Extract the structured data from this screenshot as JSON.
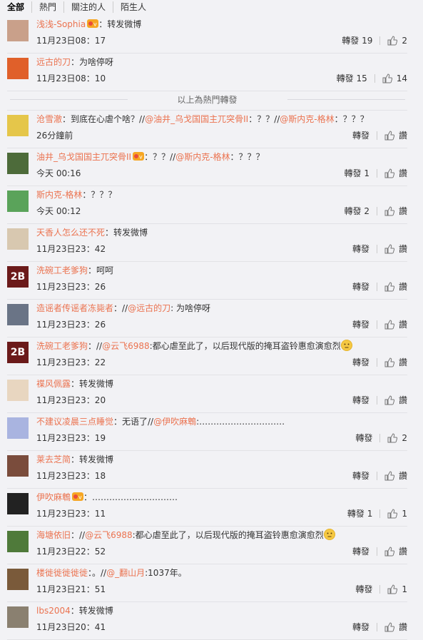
{
  "tabs": [
    "全部",
    "熱門",
    "關注的人",
    "陌生人"
  ],
  "hot_divider": "以上為熱門轉發",
  "like_label": "讚",
  "items": [
    {
      "user": "浅浅-Sophia",
      "vip": true,
      "parts": [
        {
          "t": "：转发微博",
          "m": false
        }
      ],
      "time": "11月23日08：17",
      "repost": "轉發 19",
      "like": "2",
      "av": "#c9a08a"
    },
    {
      "user": "远古的刀",
      "vip": false,
      "parts": [
        {
          "t": "：为啥停呀",
          "m": false
        }
      ],
      "time": "11月23日08：10",
      "repost": "轉發 15",
      "like": "14",
      "av": "#e0602a"
    },
    {
      "divider": true
    },
    {
      "user": "沧雪澈",
      "vip": false,
      "parts": [
        {
          "t": "：到底在心虐个啥？//",
          "m": false
        },
        {
          "t": "@油井_乌戈国国主兀突骨II",
          "m": true
        },
        {
          "t": "：？？//",
          "m": false
        },
        {
          "t": "@斯内克-格林",
          "m": true
        },
        {
          "t": "：？？？",
          "m": false
        }
      ],
      "time": "26分鐘前",
      "repost": "轉發",
      "like": "讚",
      "av": "#e5c64a"
    },
    {
      "user": "油井_乌戈国国主兀突骨II",
      "vip": true,
      "parts": [
        {
          "t": "：？？//",
          "m": false
        },
        {
          "t": "@斯内克-格林",
          "m": true
        },
        {
          "t": "：？？？",
          "m": false
        }
      ],
      "time": "今天 00:16",
      "repost": "轉發 1",
      "like": "讚",
      "av": "#4d6b3a"
    },
    {
      "user": "斯内克-格林",
      "vip": false,
      "parts": [
        {
          "t": "：？？？",
          "m": false
        }
      ],
      "time": "今天 00:12",
      "repost": "轉發 2",
      "like": "讚",
      "av": "#5aa35a"
    },
    {
      "user": "天香人怎么还不死",
      "vip": false,
      "parts": [
        {
          "t": "：转发微博",
          "m": false
        }
      ],
      "time": "11月23日23：42",
      "repost": "轉發",
      "like": "讚",
      "av": "#d8c8b0"
    },
    {
      "user": "洗碗工老爹狗",
      "vip": false,
      "parts": [
        {
          "t": "：呵呵",
          "m": false
        }
      ],
      "time": "11月23日23：26",
      "repost": "轉發",
      "like": "讚",
      "av": "#6b1a1a",
      "avText": "2B"
    },
    {
      "user": "造谣者传谣者冻毙者",
      "vip": false,
      "parts": [
        {
          "t": "：//",
          "m": false
        },
        {
          "t": "@远古的刀",
          "m": true
        },
        {
          "t": ": 为啥停呀",
          "m": false
        }
      ],
      "time": "11月23日23：26",
      "repost": "轉發",
      "like": "讚",
      "av": "#6a7486"
    },
    {
      "user": "洗碗工老爹狗",
      "vip": false,
      "parts": [
        {
          "t": "：//",
          "m": false
        },
        {
          "t": "@云飞6988",
          "m": true
        },
        {
          "t": ":都心虐至此了，以后现代版的掩耳盗铃惠愈演愈烈",
          "m": false
        }
      ],
      "emoji": true,
      "time": "11月23日23：22",
      "repost": "轉發",
      "like": "讚",
      "av": "#6b1a1a",
      "avText": "2B"
    },
    {
      "user": "褋风佩露",
      "vip": false,
      "parts": [
        {
          "t": "：转发微博",
          "m": false
        }
      ],
      "time": "11月23日23：20",
      "repost": "轉發",
      "like": "讚",
      "av": "#e8d6c0"
    },
    {
      "user": "不建议凌晨三点睡觉",
      "vip": false,
      "parts": [
        {
          "t": "：无语了//",
          "m": false
        },
        {
          "t": "@伊吹麻鵯",
          "m": true
        },
        {
          "t": ":…………………………",
          "m": false
        }
      ],
      "time": "11月23日23：19",
      "repost": "轉發",
      "like": "2",
      "av": "#a9b4e0"
    },
    {
      "user": "莱去芝简",
      "vip": false,
      "parts": [
        {
          "t": "：转发微博",
          "m": false
        }
      ],
      "time": "11月23日23：18",
      "repost": "轉發",
      "like": "讚",
      "av": "#7a4c3c"
    },
    {
      "user": "伊吹麻鵯",
      "vip": true,
      "parts": [
        {
          "t": "：…………………………",
          "m": false
        }
      ],
      "time": "11月23日23：11",
      "repost": "轉發 1",
      "like": "1",
      "av": "#222222"
    },
    {
      "user": "海塘依旧",
      "vip": false,
      "parts": [
        {
          "t": "：//",
          "m": false
        },
        {
          "t": "@云飞6988",
          "m": true
        },
        {
          "t": ":都心虐至此了，以后现代版的掩耳盗铃惠愈演愈烈",
          "m": false
        }
      ],
      "emoji": true,
      "time": "11月23日22：52",
      "repost": "轉發",
      "like": "讚",
      "av": "#4f7a3a"
    },
    {
      "user": "楼徙徙徙徙徙",
      "vip": false,
      "parts": [
        {
          "t": "：。//",
          "m": false
        },
        {
          "t": "@_翻山月",
          "m": true
        },
        {
          "t": ":1037年。",
          "m": false
        }
      ],
      "time": "11月23日21：51",
      "repost": "轉發",
      "like": "1",
      "av": "#7a5a3a"
    },
    {
      "user": "lbs2004",
      "vip": false,
      "parts": [
        {
          "t": "：转发微博",
          "m": false
        }
      ],
      "time": "11月23日20：41",
      "repost": "轉發",
      "like": "讚",
      "av": "#8a8070"
    }
  ]
}
